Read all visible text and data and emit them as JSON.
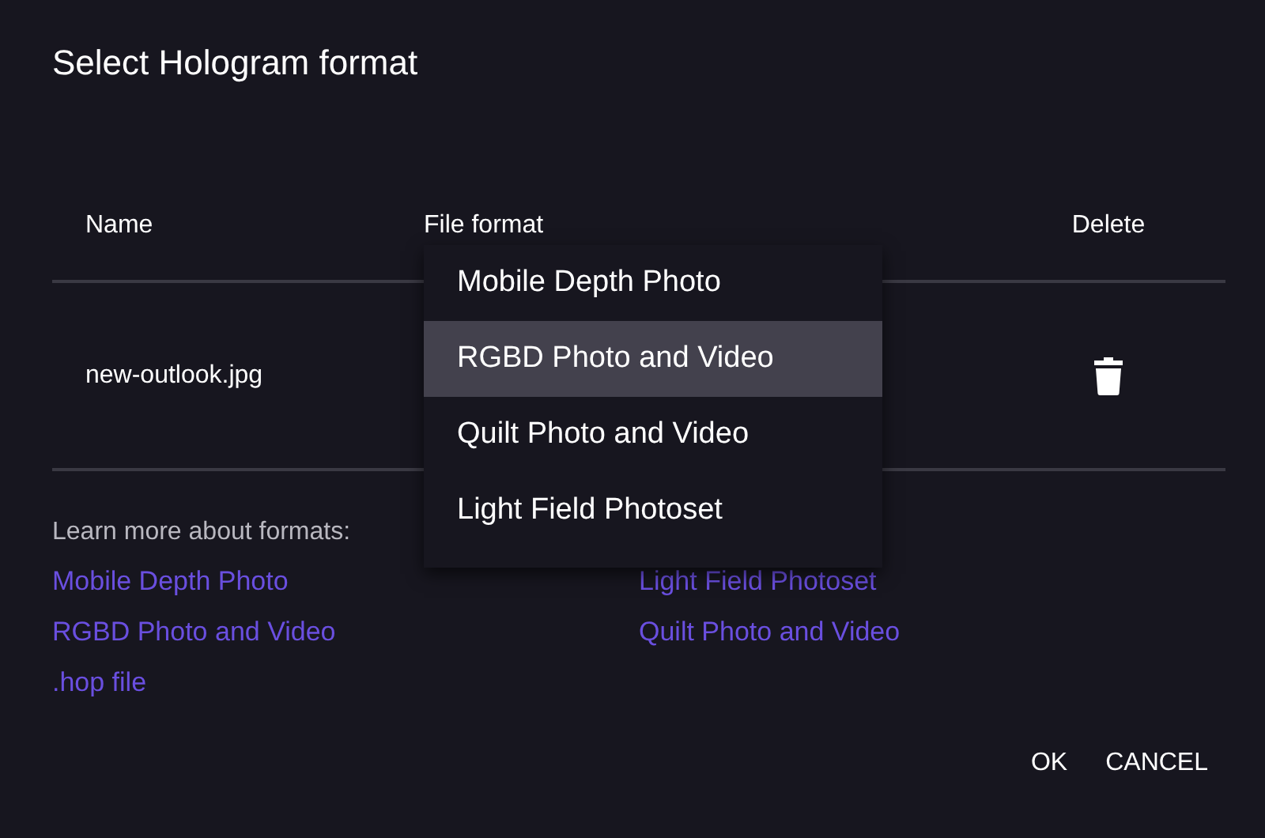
{
  "dialog": {
    "title": "Select Hologram format"
  },
  "table": {
    "columns": [
      "Name",
      "File format",
      "Delete"
    ],
    "rows": [
      {
        "name": "new-outlook.jpg"
      }
    ]
  },
  "format_menu": {
    "items": [
      {
        "label": "Mobile Depth Photo",
        "selected": false
      },
      {
        "label": "RGBD Photo and Video",
        "selected": true
      },
      {
        "label": "Quilt Photo and Video",
        "selected": false
      },
      {
        "label": "Light Field Photoset",
        "selected": false
      }
    ]
  },
  "learn_more": {
    "label": "Learn more about formats:",
    "links": [
      "Mobile Depth Photo",
      "Light Field Photoset",
      "RGBD Photo and Video",
      "Quilt Photo and Video",
      ".hop file"
    ]
  },
  "buttons": [
    "OK",
    "CANCEL"
  ]
}
